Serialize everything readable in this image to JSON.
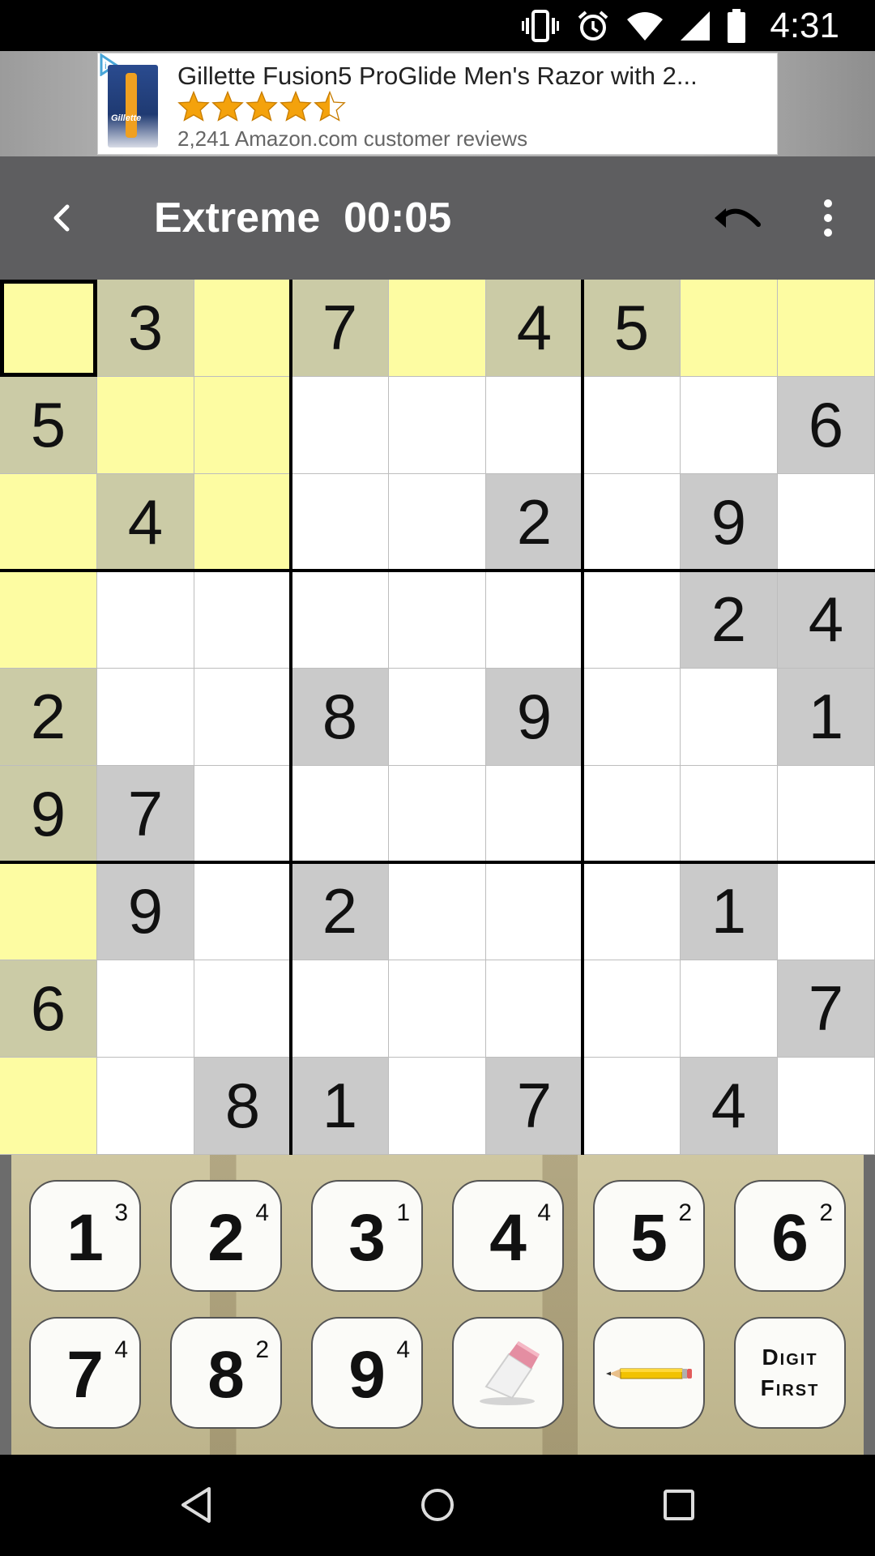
{
  "status_bar": {
    "time": "4:31",
    "icons": [
      "vibrate-icon",
      "alarm-icon",
      "wifi-icon",
      "signal-icon",
      "battery-icon"
    ]
  },
  "ad": {
    "title": "Gillette Fusion5 ProGlide Men's Razor with 2...",
    "rating": 4.5,
    "rating_max": 5,
    "reviews": "2,241 Amazon.com customer reviews",
    "thumb_logo": "Gillette"
  },
  "toolbar": {
    "title": "Extreme  00:05",
    "icons": [
      "back-arrow-icon",
      "undo-icon",
      "more-vert-icon"
    ]
  },
  "board": {
    "rows": [
      [
        "",
        "3",
        "",
        "7",
        "",
        "4",
        "5",
        "",
        ""
      ],
      [
        "5",
        "",
        "",
        "",
        "",
        "",
        "",
        "",
        "6"
      ],
      [
        "",
        "4",
        "",
        "",
        "",
        "2",
        "",
        "9",
        ""
      ],
      [
        "",
        "",
        "",
        "",
        "",
        "",
        "",
        "2",
        "4"
      ],
      [
        "2",
        "",
        "",
        "8",
        "",
        "9",
        "",
        "",
        "1"
      ],
      [
        "9",
        "7",
        "",
        "",
        "",
        "",
        "",
        "",
        ""
      ],
      [
        "",
        "9",
        "",
        "2",
        "",
        "",
        "",
        "1",
        ""
      ],
      [
        "6",
        "",
        "",
        "",
        "",
        "",
        "",
        "",
        "7"
      ],
      [
        "",
        "",
        "8",
        "1",
        "",
        "7",
        "",
        "4",
        ""
      ]
    ],
    "selected": {
      "row": 0,
      "col": 0
    },
    "colors": {
      "highlight": "#fdfca2",
      "given": "#cacaca",
      "given_highlight": "#cbcba6"
    }
  },
  "keypad": {
    "keys": [
      {
        "digit": "1",
        "count": "3"
      },
      {
        "digit": "2",
        "count": "4"
      },
      {
        "digit": "3",
        "count": "1"
      },
      {
        "digit": "4",
        "count": "4"
      },
      {
        "digit": "5",
        "count": "2"
      },
      {
        "digit": "6",
        "count": "2"
      },
      {
        "digit": "7",
        "count": "4"
      },
      {
        "digit": "8",
        "count": "2"
      },
      {
        "digit": "9",
        "count": "4"
      }
    ],
    "eraser_icon": "eraser-icon",
    "pencil_icon": "pencil-icon",
    "digit_first_line1": "Digit",
    "digit_first_line2": "First"
  },
  "navbar": {
    "icons": [
      "nav-back-icon",
      "nav-home-icon",
      "nav-recents-icon"
    ]
  }
}
